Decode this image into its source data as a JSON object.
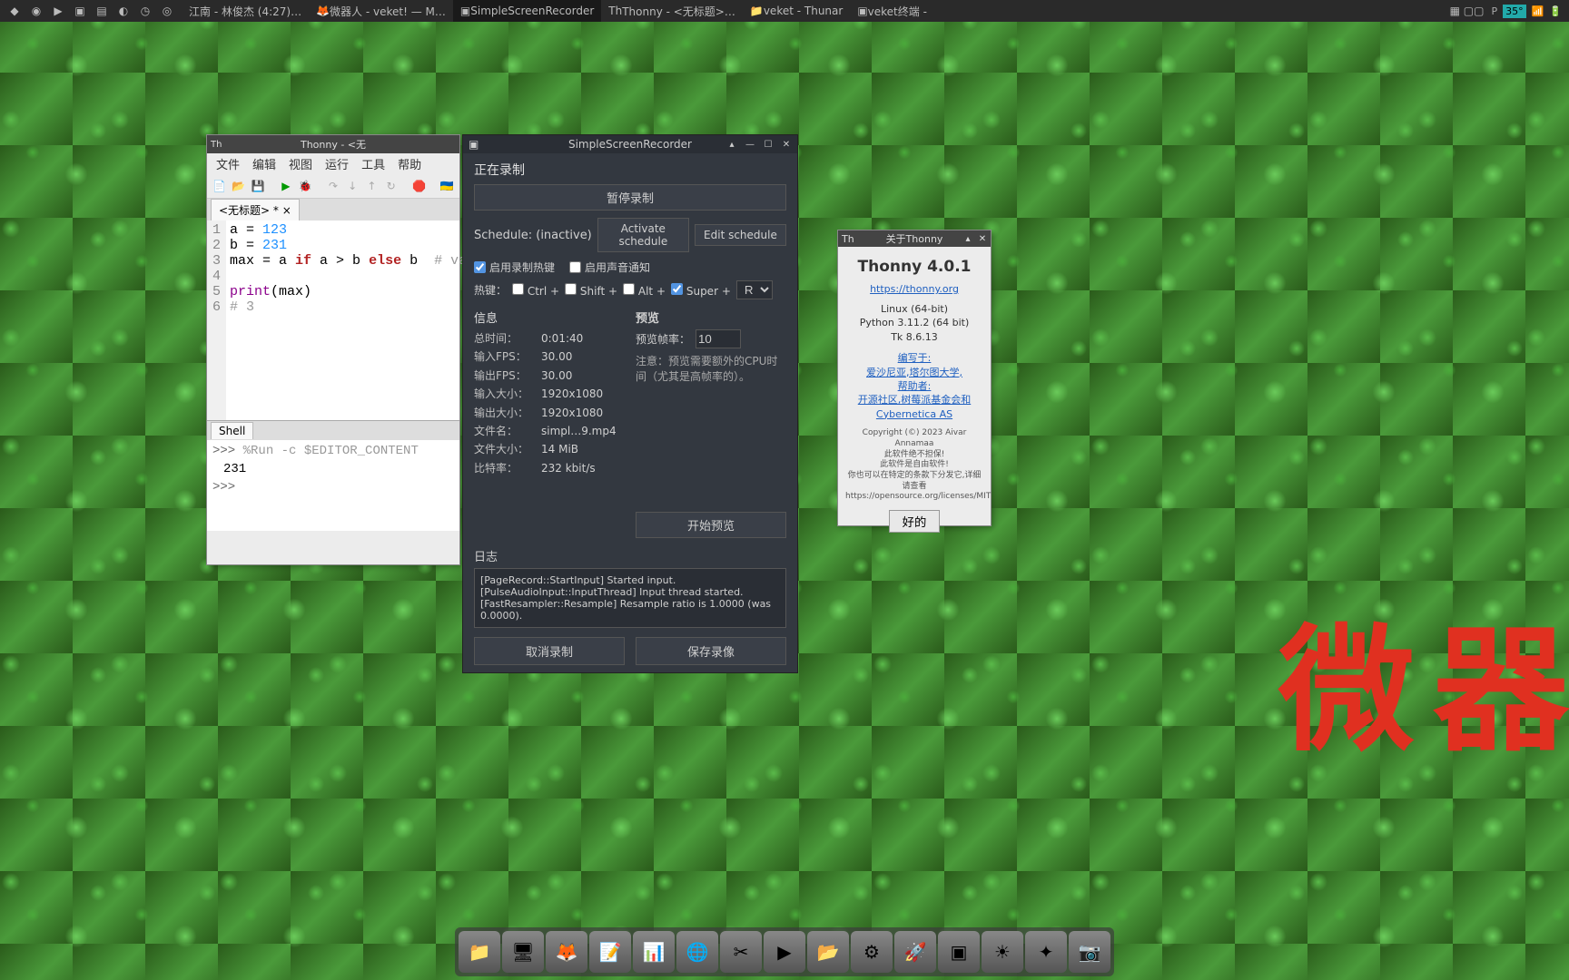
{
  "taskbar": {
    "items": [
      {
        "label": "江南 - 林俊杰 (4:27)…"
      },
      {
        "label": "微器人 - veket! — M…"
      },
      {
        "label": "SimpleScreenRecorder"
      },
      {
        "label": "Thonny  -  <无标题>…"
      },
      {
        "label": "veket - Thunar"
      },
      {
        "label": "veket终端 -"
      }
    ],
    "temp": "35°"
  },
  "thonny": {
    "title": "Thonny  -  <无",
    "menu": [
      "文件",
      "编辑",
      "视图",
      "运行",
      "工具",
      "帮助"
    ],
    "tab": "<无标题> * ",
    "code": {
      "l1_a": "a = ",
      "l1_n": "123",
      "l2_a": "b = ",
      "l2_n": "231",
      "l3_a": "max = a ",
      "l3_if": "if",
      "l3_b": " a > b ",
      "l3_else": "else",
      "l3_c": " b",
      "l3_cm": "  # va",
      "l5_a": "print",
      "l5_b": "(max)",
      "l6": "# 3"
    },
    "shell_tab": "Shell",
    "shell": {
      "run": "%Run -c $EDITOR_CONTENT",
      "out": "231",
      "prompt": ">>>"
    }
  },
  "ssr": {
    "title": "SimpleScreenRecorder",
    "recording": "正在录制",
    "pause_btn": "暂停录制",
    "schedule_label": "Schedule: (inactive)",
    "activate": "Activate schedule",
    "edit": "Edit schedule",
    "enable_hotkey": "启用录制热键",
    "enable_sound": "启用声音通知",
    "hotkey_label": "热键：",
    "ctrl": "Ctrl +",
    "shift": "Shift +",
    "alt": "Alt +",
    "super": "Super +",
    "key": "R",
    "info_header": "信息",
    "info": {
      "time_l": "总时间：",
      "time_v": "0:01:40",
      "infps_l": "输入FPS：",
      "infps_v": "30.00",
      "outfps_l": "输出FPS：",
      "outfps_v": "30.00",
      "insize_l": "输入大小：",
      "insize_v": "1920x1080",
      "outsize_l": "输出大小：",
      "outsize_v": "1920x1080",
      "fname_l": "文件名：",
      "fname_v": "simpl…9.mp4",
      "fsize_l": "文件大小：",
      "fsize_v": "14 MiB",
      "bitrate_l": "比特率：",
      "bitrate_v": "232 kbit/s"
    },
    "preview_header": "预览",
    "preview_rate_l": "预览帧率：",
    "preview_rate_v": "10",
    "preview_note": "注意：预览需要额外的CPU时间（尤其是高帧率的）。",
    "start_preview": "开始预览",
    "log_header": "日志",
    "log": "[PageRecord::StartInput] Started input.\n[PulseAudioInput::InputThread] Input thread started.\n[FastResampler::Resample] Resample ratio is 1.0000 (was 0.0000).",
    "cancel_btn": "取消录制",
    "save_btn": "保存录像"
  },
  "about": {
    "title": "关于Thonny",
    "heading": "Thonny 4.0.1",
    "url": "https://thonny.org",
    "os": "Linux (64-bit)",
    "py": "Python 3.11.2 (64 bit)",
    "tk": "Tk 8.6.13",
    "written": "编写于:",
    "uni": "爱沙尼亚,塔尔图大学,",
    "helpers": "帮助者:",
    "community": "开源社区,树莓派基金会和Cybernetica AS",
    "copyright": "Copyright (©) 2023 Aivar Annamaa",
    "warranty": "此软件绝不担保!",
    "free": "此软件是自由软件!",
    "redist": "你也可以在特定的条款下分发它,详细请查看",
    "license": "https://opensource.org/licenses/MIT",
    "ok": "好的"
  },
  "watermark": "微器"
}
